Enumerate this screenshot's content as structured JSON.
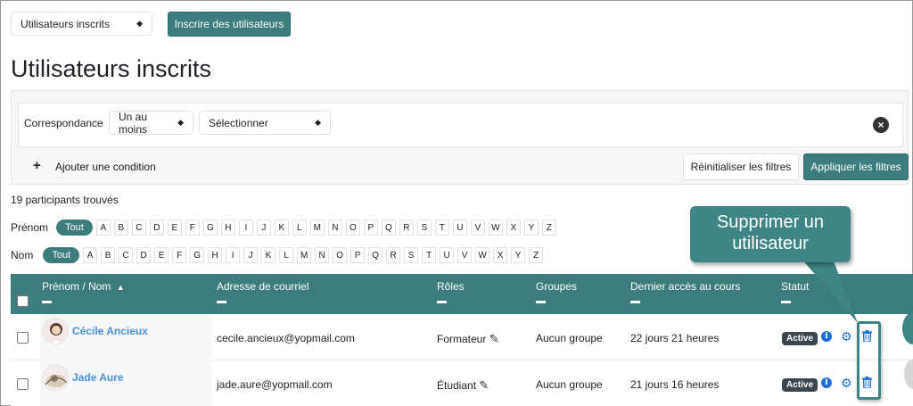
{
  "header": {
    "view_select": "Utilisateurs inscrits",
    "enrol_button": "Inscrire des utilisateurs",
    "page_title": "Utilisateurs inscrits"
  },
  "filters": {
    "match_label": "Correspondance",
    "match_value": "Un au moins",
    "type_select": "Sélectionner",
    "add_condition": "Ajouter une condition",
    "reset_button": "Réinitialiser les filtres",
    "apply_button": "Appliquer les filtres"
  },
  "summary": {
    "count_text": "19 participants trouvés"
  },
  "initials": {
    "firstname_label": "Prénom",
    "lastname_label": "Nom",
    "all_label": "Tout",
    "letters": [
      "A",
      "B",
      "C",
      "D",
      "E",
      "F",
      "G",
      "H",
      "I",
      "J",
      "K",
      "L",
      "M",
      "N",
      "O",
      "P",
      "Q",
      "R",
      "S",
      "T",
      "U",
      "V",
      "W",
      "X",
      "Y",
      "Z"
    ]
  },
  "table": {
    "headers": {
      "name": "Prénom / Nom",
      "email": "Adresse de courriel",
      "roles": "Rôles",
      "groups": "Groupes",
      "last_access": "Dernier accès au cours",
      "status": "Statut"
    },
    "rows": [
      {
        "name": "Cécile Ancieux",
        "email": "cecile.ancieux@yopmail.com",
        "role": "Formateur",
        "groups": "Aucun groupe",
        "last_access": "22 jours 21 heures",
        "status": "Active"
      },
      {
        "name": "Jade Aure",
        "email": "jade.aure@yopmail.com",
        "role": "Étudiant",
        "groups": "Aucun groupe",
        "last_access": "21 jours 16 heures",
        "status": "Active"
      }
    ]
  },
  "callout": {
    "line1": "Supprimer un",
    "line2": "utilisateur"
  },
  "icons": {
    "sort": "sort-ascending-icon",
    "info": "info-icon",
    "gear": "gear-icon",
    "trash": "trash-icon",
    "pencil": "pencil-icon",
    "close": "close-icon",
    "plus": "plus-icon"
  },
  "colors": {
    "accent": "#3d7c7c",
    "link": "#4a90d9",
    "icon_blue": "#1f6fd6",
    "badge": "#3a4750"
  }
}
